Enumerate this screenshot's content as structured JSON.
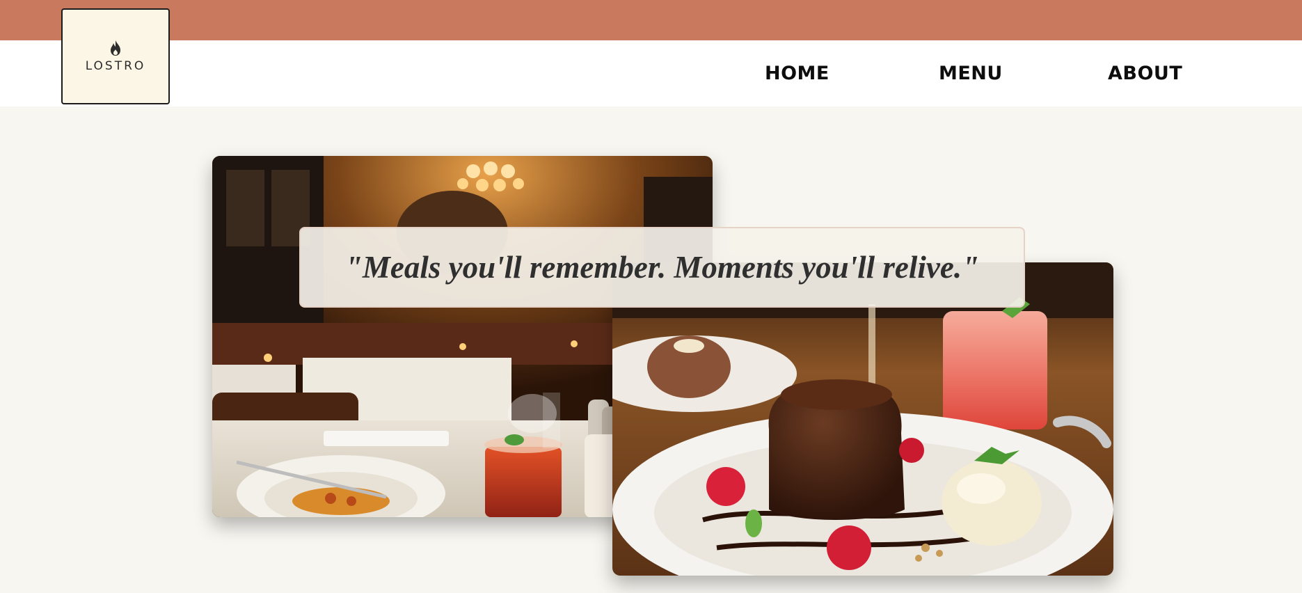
{
  "brand": {
    "logo_text": "LOSTRO",
    "logo_icon": "flame-icon"
  },
  "nav": {
    "items": [
      {
        "label": "HOME"
      },
      {
        "label": "MENU"
      },
      {
        "label": "ABOUT"
      }
    ]
  },
  "hero": {
    "quote": "\"Meals you'll remember. Moments you'll relive.\"",
    "images": [
      {
        "name": "restaurant-dining-room-photo"
      },
      {
        "name": "chocolate-lava-cake-dessert-photo"
      }
    ]
  },
  "colors": {
    "top_band": "#c8795e",
    "page_background": "#f7f6f0",
    "logo_background": "#fbf6e6",
    "nav_text": "#0d0d0d",
    "quote_text": "#2f2f2f"
  }
}
